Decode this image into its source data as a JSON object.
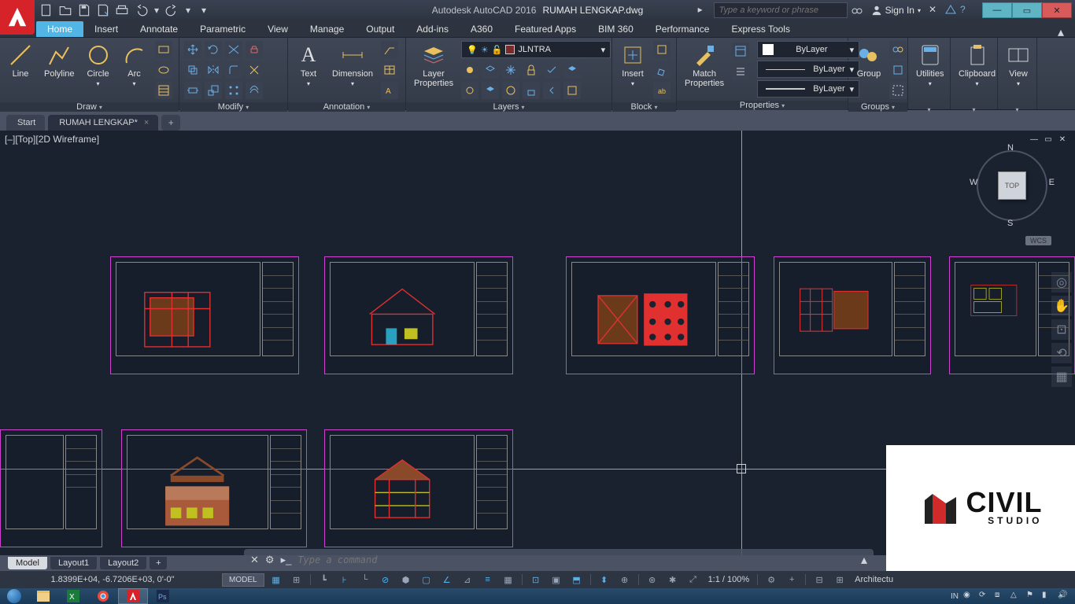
{
  "title": {
    "app": "Autodesk AutoCAD 2016",
    "file": "RUMAH LENGKAP.dwg"
  },
  "search_placeholder": "Type a keyword or phrase",
  "signin": "Sign In",
  "ribbon_tabs": [
    "Home",
    "Insert",
    "Annotate",
    "Parametric",
    "View",
    "Manage",
    "Output",
    "Add-ins",
    "A360",
    "Featured Apps",
    "BIM 360",
    "Performance",
    "Express Tools"
  ],
  "active_tab": "Home",
  "panels": {
    "draw": {
      "label": "Draw",
      "tools": [
        "Line",
        "Polyline",
        "Circle",
        "Arc"
      ]
    },
    "modify": {
      "label": "Modify"
    },
    "annotation": {
      "label": "Annotation",
      "tools": [
        "Text",
        "Dimension"
      ]
    },
    "layers": {
      "label": "Layers",
      "big": "Layer\nProperties",
      "current": "JLNTRA"
    },
    "block": {
      "label": "Block",
      "big": "Insert"
    },
    "properties": {
      "label": "Properties",
      "big": "Match\nProperties",
      "color": "ByLayer",
      "line": "ByLayer",
      "weight": "ByLayer"
    },
    "groups": {
      "label": "Groups",
      "big": "Group"
    },
    "utilities": {
      "label": "Utilities"
    },
    "clipboard": {
      "label": "Clipboard"
    },
    "view": {
      "label": "View"
    }
  },
  "file_tabs": {
    "items": [
      "Start",
      "RUMAH LENGKAP*"
    ],
    "active": 1
  },
  "view_control": "[–][Top][2D Wireframe]",
  "viewcube": {
    "face": "TOP",
    "n": "N",
    "s": "S",
    "e": "E",
    "w": "W"
  },
  "wcs": "WCS",
  "layout_tabs": {
    "items": [
      "Model",
      "Layout1",
      "Layout2"
    ],
    "active": 0
  },
  "command_placeholder": "Type a command",
  "status": {
    "coords": "1.8399E+04, -6.7206E+03, 0'-0\"",
    "mode": "MODEL",
    "scale": "1:1 / 100%",
    "workspace": "Architectu",
    "ime": "IN"
  },
  "watermark": {
    "main": "CIVIL",
    "sub": "STUDIO"
  }
}
